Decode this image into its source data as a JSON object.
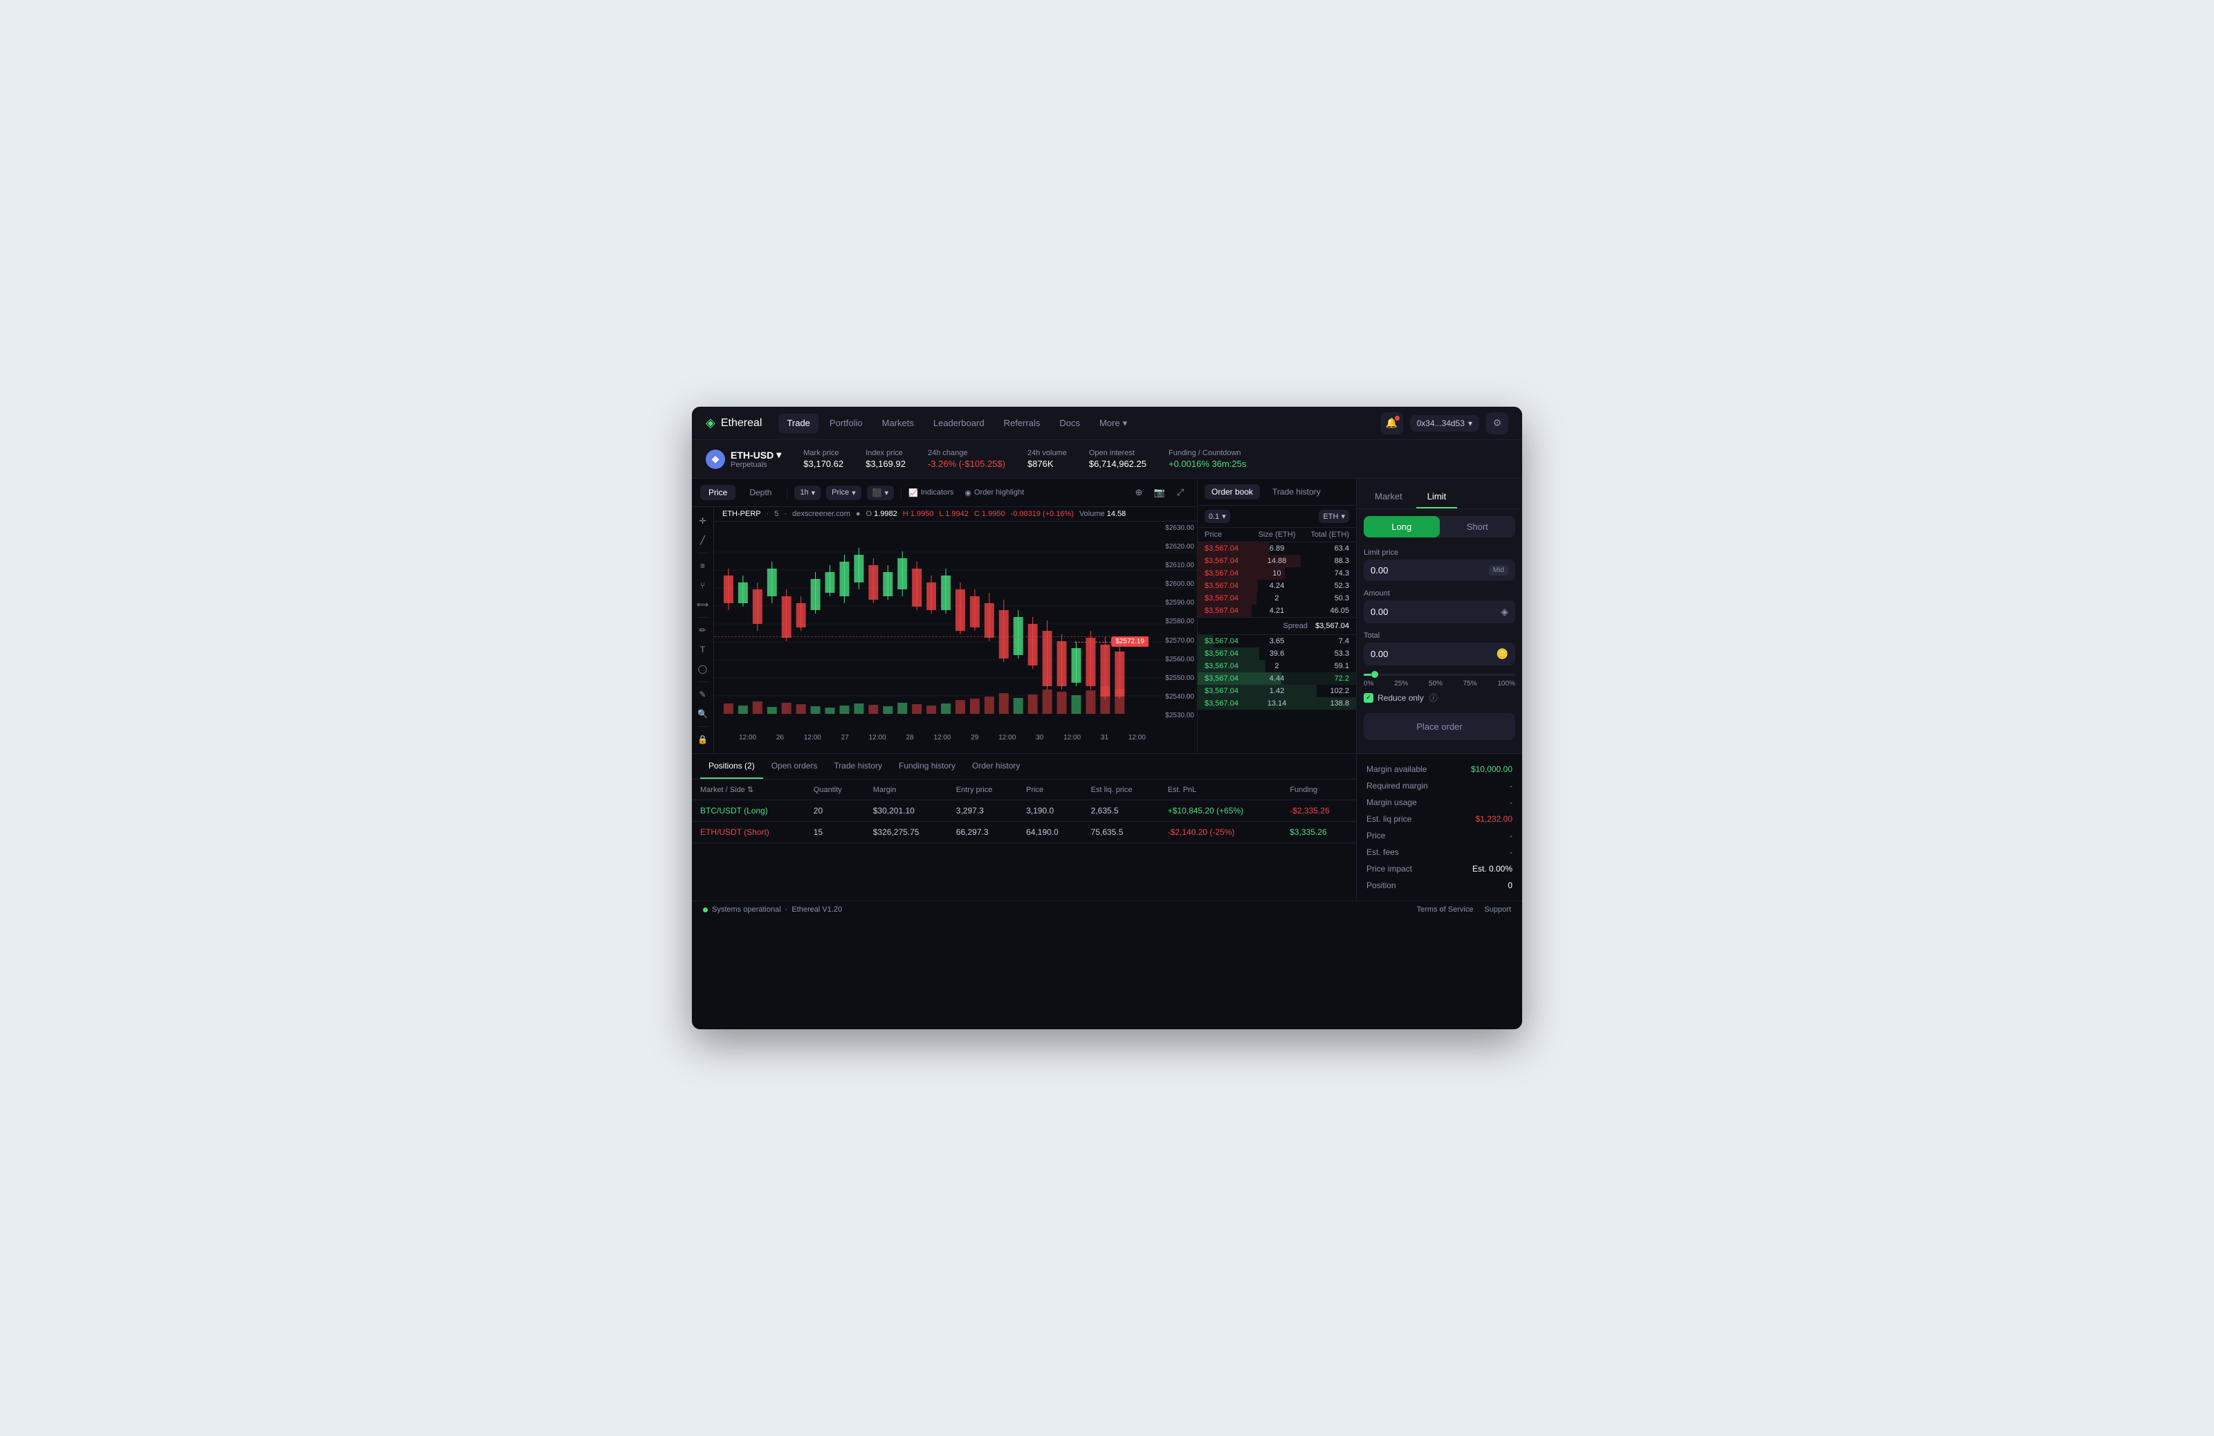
{
  "nav": {
    "logo": "Ethereal",
    "logo_icon": "◈",
    "items": [
      "Trade",
      "Portfolio",
      "Markets",
      "Leaderboard",
      "Referrals",
      "Docs"
    ],
    "more_label": "More",
    "wallet": "0x34...34d53",
    "bell_icon": "🔔",
    "settings_icon": "⚙"
  },
  "ticker": {
    "asset_icon": "◆",
    "asset_name": "ETH-USD",
    "asset_sub": "Perpetuals",
    "arrow": "▾",
    "stats": [
      {
        "label": "Mark price",
        "value": "$3,170.62",
        "class": ""
      },
      {
        "label": "Index price",
        "value": "$3,169.92",
        "class": ""
      },
      {
        "label": "24h change",
        "value": "-3.26% (-$105.25$)",
        "class": "negative"
      },
      {
        "label": "24h volume",
        "value": "$876K",
        "class": ""
      },
      {
        "label": "Open interest",
        "value": "$6,714,962.25",
        "class": ""
      },
      {
        "label": "Funding / Countdown",
        "value": "+0.0016% 36m:25s",
        "class": "positive"
      }
    ]
  },
  "chart": {
    "tabs": [
      "Price",
      "Depth"
    ],
    "active_tab": "Price",
    "timeframe": "1h",
    "type_label": "Price",
    "type_icon": "▾",
    "candle_label": "||",
    "candle_icon": "▾",
    "indicators_label": "Indicators",
    "order_highlight_label": "Order highlight",
    "info": {
      "symbol": "ETH-PERP",
      "source": "dexscreener.com",
      "o": "1.9982",
      "h": "1.9950",
      "l": "1.9942",
      "c": "1.9950",
      "chg": "-0.00319 (+0.16%)",
      "volume_label": "Volume",
      "volume": "14.58"
    },
    "price_label": "$2572.19",
    "price_levels": [
      "$2630.00",
      "$2620.00",
      "$2610.00",
      "$2600.00",
      "$2590.00",
      "$2580.00",
      "$2570.00",
      "$2560.00",
      "$2550.00",
      "$2540.00",
      "$2530.00"
    ],
    "time_labels": [
      "12:00",
      "26",
      "12:00",
      "27",
      "12:00",
      "28",
      "12:00",
      "29",
      "12:00",
      "30",
      "12:00",
      "31",
      "12:00"
    ],
    "tools": [
      "⊕",
      "📷",
      "⤢"
    ]
  },
  "order_book": {
    "tabs": [
      "Order book",
      "Trade history"
    ],
    "active_tab": "Order book",
    "size_label": "0.1",
    "currency_label": "ETH",
    "headers": [
      "Price",
      "Size (ETH)",
      "Total (ETH)"
    ],
    "asks": [
      {
        "price": "$3,567.04",
        "size": "6.89",
        "total": "63.4",
        "pct": 45
      },
      {
        "price": "$3,567.04",
        "size": "14.88",
        "total": "88.3",
        "pct": 65
      },
      {
        "price": "$3,567.04",
        "size": "10",
        "total": "74.3",
        "pct": 55
      },
      {
        "price": "$3,567.04",
        "size": "4.24",
        "total": "52.3",
        "pct": 38
      },
      {
        "price": "$3,567.04",
        "size": "2",
        "total": "50.3",
        "pct": 37
      },
      {
        "price": "$3,567.04",
        "size": "4.21",
        "total": "46.05",
        "pct": 34
      }
    ],
    "spread_label": "Spread",
    "spread_value": "$3,567.04",
    "bids": [
      {
        "price": "$3,567.04",
        "size": "3.65",
        "total": "7.4",
        "pct": 10
      },
      {
        "price": "$3,567.04",
        "size": "39.6",
        "total": "53.3",
        "pct": 39
      },
      {
        "price": "$3,567.04",
        "size": "2",
        "total": "59.1",
        "pct": 43
      },
      {
        "price": "$3,567.04",
        "size": "4.44",
        "total": "72.2",
        "pct": 53
      },
      {
        "price": "$3,567.04",
        "size": "1.42",
        "total": "102.2",
        "pct": 75
      },
      {
        "price": "$3,567.04",
        "size": "13.14",
        "total": "138.8",
        "pct": 100
      }
    ]
  },
  "order_panel": {
    "tabs": [
      "Market",
      "Limit"
    ],
    "active_tab": "Limit",
    "directions": [
      "Long",
      "Short"
    ],
    "active_direction": "Long",
    "fields": [
      {
        "label": "Limit price",
        "value": "0.00",
        "badge": "Mid"
      },
      {
        "label": "Amount",
        "value": "0.00",
        "icon": "◈"
      },
      {
        "label": "Total",
        "value": "0.00",
        "icon": "🪙"
      }
    ],
    "slider_pcts": [
      "0%",
      "25%",
      "50%",
      "75%",
      "100%"
    ],
    "reduce_only_label": "Reduce only",
    "place_order_label": "Place order"
  },
  "positions": {
    "tabs": [
      "Positions (2)",
      "Open orders",
      "Trade history",
      "Funding history",
      "Order history"
    ],
    "active_tab": "Positions (2)",
    "headers": [
      "Market / Side",
      "Quantity",
      "Margin",
      "Entry price",
      "Price",
      "Est liq. price",
      "Est. PnL",
      "Funding"
    ],
    "rows": [
      {
        "market": "BTC/USDT (Long)",
        "side": "long",
        "quantity": "20",
        "margin": "$30,201.10",
        "entry": "3,297.3",
        "price": "3,190.0",
        "liq": "2,635.5",
        "pnl": "+$10,845.20 (+65%)",
        "pnl_class": "positive",
        "funding": "-$2,335.26",
        "funding_class": "negative"
      },
      {
        "market": "ETH/USDT (Short)",
        "side": "short",
        "quantity": "15",
        "margin": "$326,275.75",
        "entry": "66,297.3",
        "price": "64,190.0",
        "liq": "75,635.5",
        "pnl": "-$2,140.20 (-25%)",
        "pnl_class": "negative",
        "funding": "$3,335.26",
        "funding_class": "positive"
      }
    ]
  },
  "margin_info": {
    "rows": [
      {
        "label": "Margin available",
        "value": "$10,000.00",
        "class": "green"
      },
      {
        "label": "Required margin",
        "value": "-",
        "class": "dash"
      },
      {
        "label": "Margin usage",
        "value": "-",
        "class": "dash"
      },
      {
        "label": "Est. liq price",
        "value": "$1,232.00",
        "class": "red"
      },
      {
        "label": "Price",
        "value": "-",
        "class": "dash"
      },
      {
        "label": "Est. fees",
        "value": "-",
        "class": "dash"
      },
      {
        "label": "Price impact",
        "value": "Est. 0.00%",
        "class": ""
      },
      {
        "label": "Position",
        "value": "0",
        "class": ""
      }
    ]
  },
  "status_bar": {
    "dot_label": "Systems operational",
    "version": "Ethereal V1.20",
    "links": [
      "Terms of Service",
      "Support"
    ]
  }
}
